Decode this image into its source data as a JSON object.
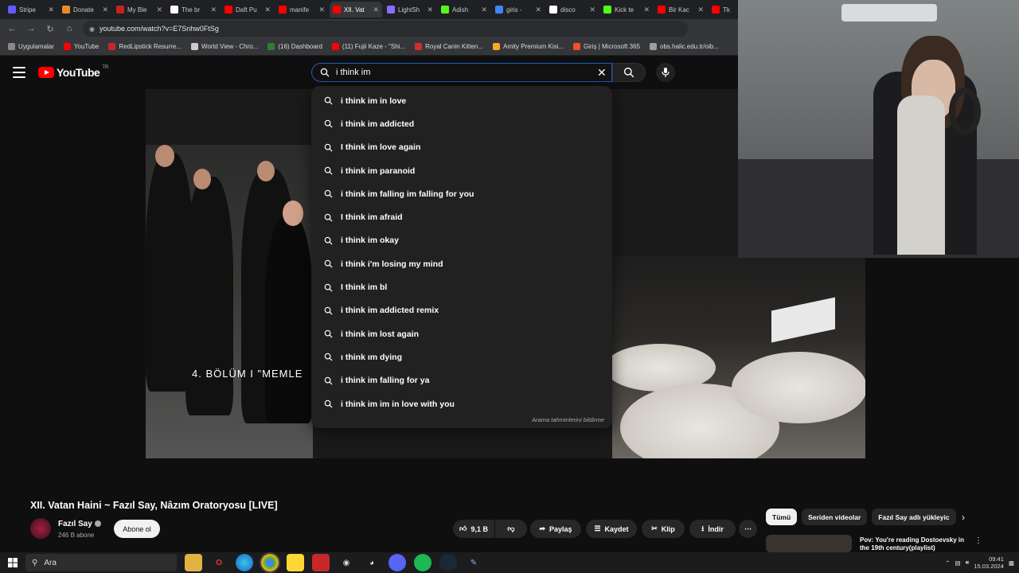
{
  "browser": {
    "tabs": [
      {
        "label": "Stripe",
        "color": "#635bff",
        "active": false
      },
      {
        "label": "Donate",
        "color": "#e88a2b",
        "active": false
      },
      {
        "label": "My Ble",
        "color": "#c5221f",
        "active": false
      },
      {
        "label": "The br",
        "color": "#ffffff",
        "active": false
      },
      {
        "label": "Daft Pu",
        "color": "#ff0000",
        "active": false
      },
      {
        "label": "manife",
        "color": "#ff0000",
        "active": false
      },
      {
        "label": "XII. Vat",
        "color": "#ff0000",
        "active": true
      },
      {
        "label": "LightSh",
        "color": "#8a6cff",
        "active": false
      },
      {
        "label": "Adish",
        "color": "#53fc18",
        "active": false
      },
      {
        "label": "giris -",
        "color": "#4285f4",
        "active": false
      },
      {
        "label": "disco",
        "color": "#ffffff",
        "active": false
      },
      {
        "label": "Kick te",
        "color": "#53fc18",
        "active": false
      },
      {
        "label": "Bir Kac",
        "color": "#ff0000",
        "active": false
      },
      {
        "label": "Tk",
        "color": "#ff0000",
        "active": false
      }
    ],
    "address": "youtube.com/watch?v=E7Snhw0FtSg",
    "bookmarks": [
      {
        "label": "Uygulamalar",
        "color": "#888888"
      },
      {
        "label": "YouTube",
        "color": "#ff0000"
      },
      {
        "label": "RedLipstick Resurre...",
        "color": "#c62828"
      },
      {
        "label": "World View - Chro...",
        "color": "#cccccc"
      },
      {
        "label": "(16) Dashboard",
        "color": "#2e7d32"
      },
      {
        "label": "(11) Fujii Kaze - \"Shi...",
        "color": "#ff0000"
      },
      {
        "label": "Royal Canin Kitten...",
        "color": "#d32f2f"
      },
      {
        "label": "Amity Premium Kisi...",
        "color": "#f9a825"
      },
      {
        "label": "Giriş | Microsoft 365",
        "color": "#f25022"
      },
      {
        "label": "obs.halic.edu.tr/oib...",
        "color": "#9e9e9e"
      }
    ]
  },
  "youtube": {
    "logo_text": "YouTube",
    "region": "TR",
    "search_value": "i think im",
    "suggestions": [
      "i think im in love",
      "i think im addicted",
      "I think im love again",
      "i think im paranoid",
      "i think im falling im falling for you",
      "I think im afraid",
      "i think im okay",
      "i think i'm losing my mind",
      "I think im bl",
      "i think im addicted remix",
      "i think im lost again",
      "ı think ım dying",
      "i think im falling for ya",
      "i think im im in love with you"
    ],
    "report_predictions": "Arama tahminlerini bildirme",
    "video_overlay": "4. BÖLÜM  I  \"MEMLE",
    "video_title": "XII. Vatan Haini ~ Fazıl Say, Nâzım Oratoryosu [LIVE]",
    "channel": {
      "name": "Fazıl Say",
      "subscribers": "246 B abone",
      "subscribe_label": "Abone ol"
    },
    "actions": {
      "likes": "9,1 B",
      "share": "Paylaş",
      "save": "Kaydet",
      "clip": "Klip",
      "download": "İndir"
    },
    "chips": [
      "Tümü",
      "Seriden videolar",
      "Fazıl Say adlı yükleyic"
    ],
    "related_title": "Pov: You're reading Dostoevsky in the 19th century(playlist)"
  },
  "taskbar": {
    "search_placeholder": "Ara",
    "time": "09:41",
    "date": "15.03.2024"
  },
  "colors": {
    "accent_red": "#ff0000",
    "focus_blue": "#1c62b9"
  }
}
